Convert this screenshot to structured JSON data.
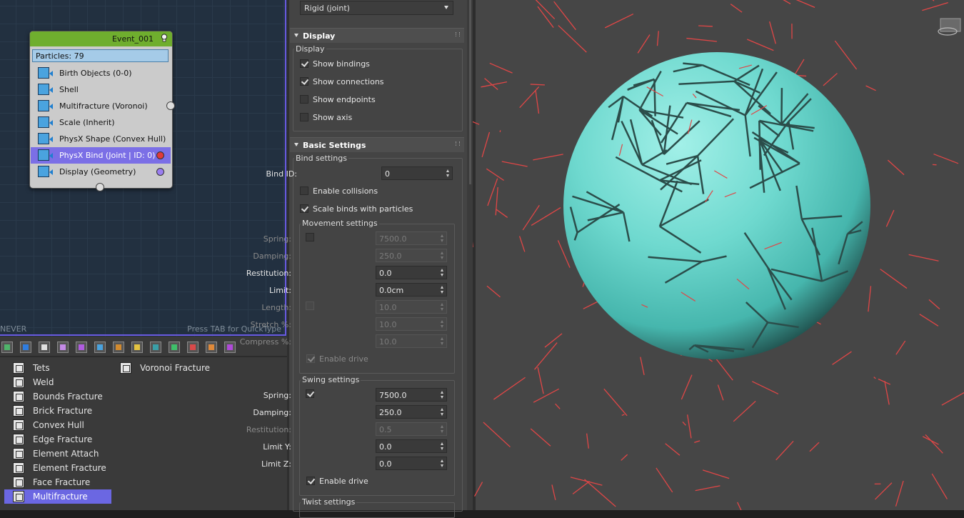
{
  "node_editor": {
    "event": {
      "title": "Event_001",
      "particles": "Particles: 79",
      "operators": [
        {
          "label": "Birth Objects (0-0)",
          "icon": "birth-objects-icon"
        },
        {
          "label": "Shell",
          "icon": "shell-icon"
        },
        {
          "label": "Multifracture (Voronoi)",
          "icon": "multifracture-icon"
        },
        {
          "label": "Scale (Inherit)",
          "icon": "scale-icon"
        },
        {
          "label": "PhysX Shape (Convex Hull)",
          "icon": "physx-shape-icon"
        },
        {
          "label": "PhysX Bind (Joint | ID: 0)",
          "icon": "physx-bind-icon",
          "selected": true,
          "dot_color": "#e03a3a"
        },
        {
          "label": "Display (Geometry)",
          "icon": "display-icon",
          "dot_color": "#9a7ef0"
        }
      ]
    },
    "status_left": "NEVER",
    "hint": "Press TAB for QuickType"
  },
  "depot": {
    "toolbar_colors": [
      "#4fb46a",
      "#2f7de0",
      "#e0e0e0",
      "#c48ae6",
      "#b05ce0",
      "#4aa3df",
      "#d18a2f",
      "#e3c341",
      "#3a9fa8",
      "#3fbf6a",
      "#d84a4a",
      "#e08a3a",
      "#b04ad8"
    ],
    "col1": [
      "Tets",
      "Weld",
      "Bounds Fracture",
      "Brick Fracture",
      "Convex Hull",
      "Edge Fracture",
      "Element Attach",
      "Element Fracture",
      "Face Fracture",
      "Multifracture"
    ],
    "col2": [
      "Voronoi Fracture"
    ],
    "selected": "Multifracture"
  },
  "panel": {
    "type_dropdown": "Rigid (joint)",
    "display": {
      "title": "Display",
      "group": "Display",
      "checks": [
        {
          "label": "Show bindings",
          "checked": true
        },
        {
          "label": "Show connections",
          "checked": true
        },
        {
          "label": "Show endpoints",
          "checked": false
        },
        {
          "label": "Show axis",
          "checked": false
        }
      ]
    },
    "basic": {
      "title": "Basic Settings",
      "bind_group": "Bind settings",
      "bind_id_label": "Bind ID:",
      "bind_id_value": "0",
      "enable_collisions": "Enable collisions",
      "scale_binds": "Scale binds with particles",
      "movement": {
        "title": "Movement settings",
        "spring_label": "Spring:",
        "spring_value": "7500.0",
        "damping_label": "Damping:",
        "damping_value": "250.0",
        "restitution_label": "Restitution:",
        "restitution_value": "0.0",
        "limit_label": "Limit:",
        "limit_value": "0.0cm",
        "length_label": "Length:",
        "length_value": "10.0",
        "stretch_label": "Stretch %:",
        "stretch_value": "10.0",
        "compress_label": "Compress %:",
        "compress_value": "10.0",
        "enable_drive": "Enable drive"
      },
      "swing": {
        "title": "Swing settings",
        "spring_label": "Spring:",
        "spring_value": "7500.0",
        "damping_label": "Damping:",
        "damping_value": "250.0",
        "restitution_label": "Restitution:",
        "restitution_value": "0.5",
        "limit_y_label": "Limit Y:",
        "limit_y_value": "0.0",
        "limit_z_label": "Limit Z:",
        "limit_z_value": "0.0",
        "enable_drive": "Enable drive"
      },
      "twist_title": "Twist settings"
    }
  },
  "viewport": {
    "sphere_color": "#6fd9cf",
    "line_color": "#e04646"
  }
}
